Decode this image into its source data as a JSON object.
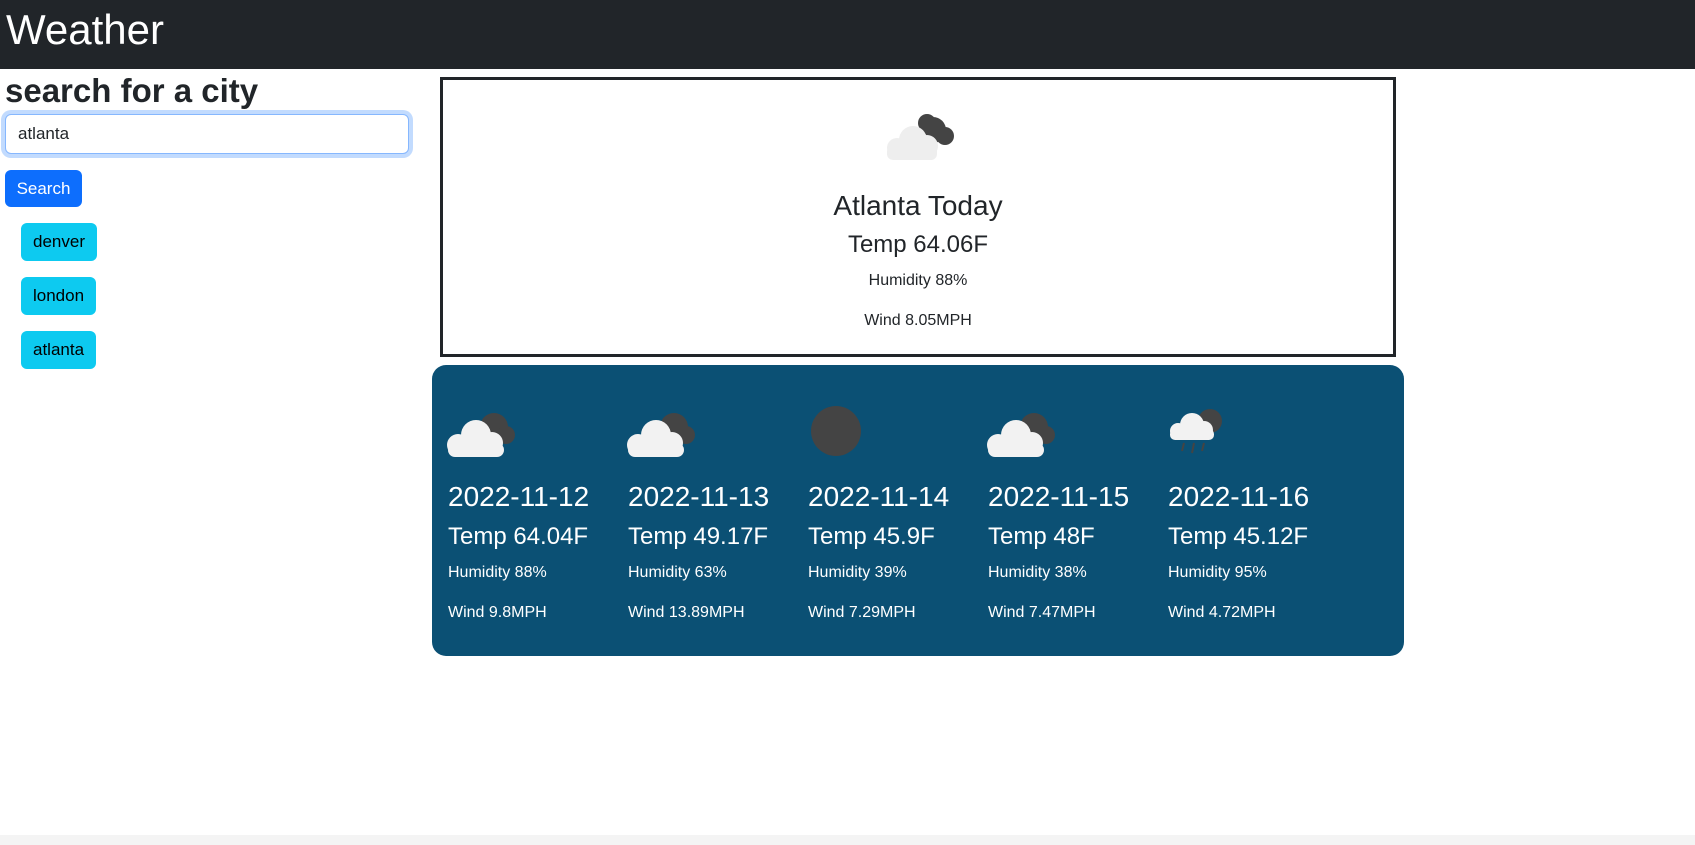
{
  "navbar": {
    "title": "Weather"
  },
  "search": {
    "heading": "search for a city",
    "input_value": "atlanta",
    "button_label": "Search"
  },
  "history": [
    {
      "label": "denver"
    },
    {
      "label": "london"
    },
    {
      "label": "atlanta"
    }
  ],
  "today": {
    "icon": "clouds-icon",
    "title": "Atlanta Today",
    "temp": "Temp 64.06F",
    "humidity": "Humidity 88%",
    "wind": "Wind 8.05MPH"
  },
  "forecast": [
    {
      "icon": "clouds-icon",
      "date": "2022-11-12",
      "temp": "Temp 64.04F",
      "humidity": "Humidity 88%",
      "wind": "Wind 9.8MPH"
    },
    {
      "icon": "clouds-icon",
      "date": "2022-11-13",
      "temp": "Temp 49.17F",
      "humidity": "Humidity 63%",
      "wind": "Wind 13.89MPH"
    },
    {
      "icon": "clear-night-icon",
      "date": "2022-11-14",
      "temp": "Temp 45.9F",
      "humidity": "Humidity 39%",
      "wind": "Wind 7.29MPH"
    },
    {
      "icon": "clouds-icon",
      "date": "2022-11-15",
      "temp": "Temp 48F",
      "humidity": "Humidity 38%",
      "wind": "Wind 7.47MPH"
    },
    {
      "icon": "rain-icon",
      "date": "2022-11-16",
      "temp": "Temp 45.12F",
      "humidity": "Humidity 95%",
      "wind": "Wind 4.72MPH"
    }
  ],
  "colors": {
    "navbar": "#212529",
    "primary": "#0d6efd",
    "info": "#0dcaf0",
    "forecast_bg": "#0b5074"
  }
}
